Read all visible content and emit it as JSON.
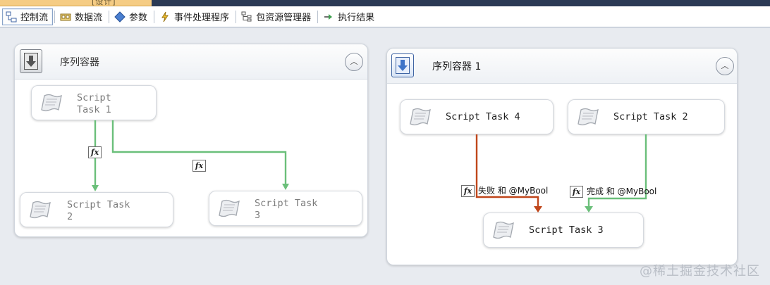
{
  "top_tab": {
    "label": "[设计]"
  },
  "tabs": [
    {
      "id": "control-flow",
      "label": "控制流",
      "icon": "control-flow-icon",
      "active": true
    },
    {
      "id": "data-flow",
      "label": "数据流",
      "icon": "data-flow-icon",
      "active": false
    },
    {
      "id": "parameters",
      "label": "参数",
      "icon": "parameters-icon",
      "active": false
    },
    {
      "id": "event-handlers",
      "label": "事件处理程序",
      "icon": "lightning-icon",
      "active": false
    },
    {
      "id": "package-explorer",
      "label": "包资源管理器",
      "icon": "tree-icon",
      "active": false
    },
    {
      "id": "execution-results",
      "label": "执行结果",
      "icon": "play-icon",
      "active": false
    }
  ],
  "container_left": {
    "title": "序列容器",
    "tasks": [
      {
        "label": "Script\nTask 1"
      },
      {
        "label": "Script Task\n2"
      },
      {
        "label": "Script Task\n3"
      }
    ],
    "expression_icon": "fx"
  },
  "container_right": {
    "title": "序列容器 1",
    "tasks": [
      {
        "label": "Script Task 4"
      },
      {
        "label": "Script Task 2"
      },
      {
        "label": "Script Task 3"
      }
    ],
    "constraints": [
      {
        "icon": "fx",
        "label": "失败 和 @MyBool",
        "color": "#c0461b"
      },
      {
        "icon": "fx",
        "label": "完成 和 @MyBool",
        "color": "#6bbf7a"
      }
    ]
  },
  "colors": {
    "success": "#6bbf7a",
    "failure": "#c0461b",
    "accent_blue": "#3f64a3"
  },
  "watermark": "@稀土掘金技术社区"
}
